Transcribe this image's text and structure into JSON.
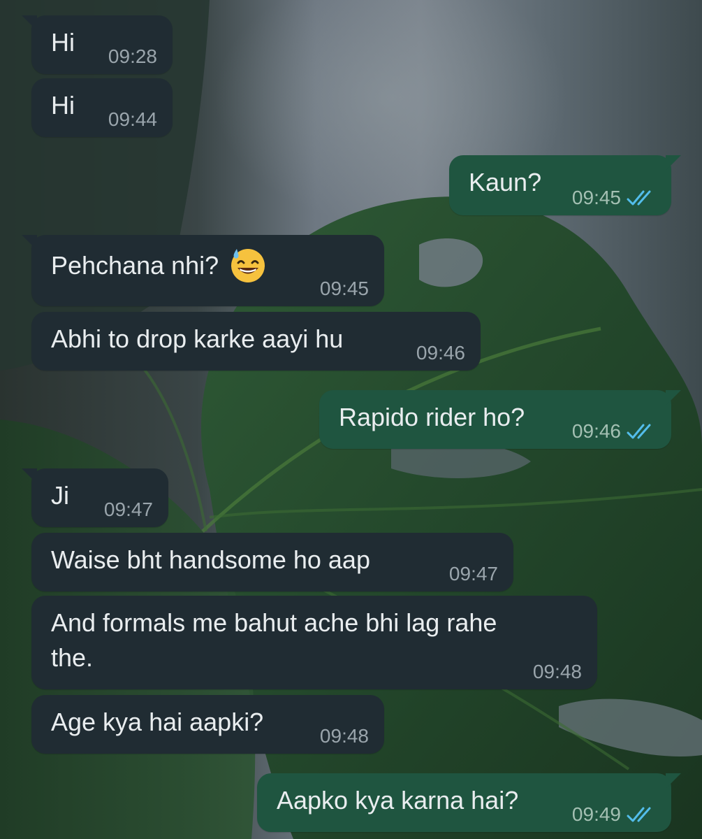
{
  "colors": {
    "incoming_bubble": "#202c33",
    "outgoing_bubble": "#1f5540",
    "text": "#e9edef",
    "timestamp": "#9aa5ac",
    "read_ticks": "#53bdeb"
  },
  "messages": [
    {
      "direction": "in",
      "text": "Hi",
      "time": "09:28"
    },
    {
      "direction": "in",
      "text": "Hi",
      "time": "09:44"
    },
    {
      "direction": "out",
      "text": "Kaun?",
      "time": "09:45",
      "status": "read",
      "status_icon": "double-check-icon"
    },
    {
      "direction": "in",
      "text": "Pehchana nhi?",
      "emoji": "grinning-face-with-sweat",
      "time": "09:45"
    },
    {
      "direction": "in",
      "text": "Abhi to drop karke aayi hu",
      "time": "09:46"
    },
    {
      "direction": "out",
      "text": "Rapido rider ho?",
      "time": "09:46",
      "status": "read",
      "status_icon": "double-check-icon"
    },
    {
      "direction": "in",
      "text": "Ji",
      "time": "09:47"
    },
    {
      "direction": "in",
      "text": "Waise bht handsome ho aap",
      "time": "09:47"
    },
    {
      "direction": "in",
      "text": "And formals me bahut ache bhi lag rahe the.",
      "time": "09:48"
    },
    {
      "direction": "in",
      "text": "Age kya hai aapki?",
      "time": "09:48"
    },
    {
      "direction": "out",
      "text": "Aapko kya karna hai?",
      "time": "09:49",
      "status": "read",
      "status_icon": "double-check-icon"
    }
  ]
}
